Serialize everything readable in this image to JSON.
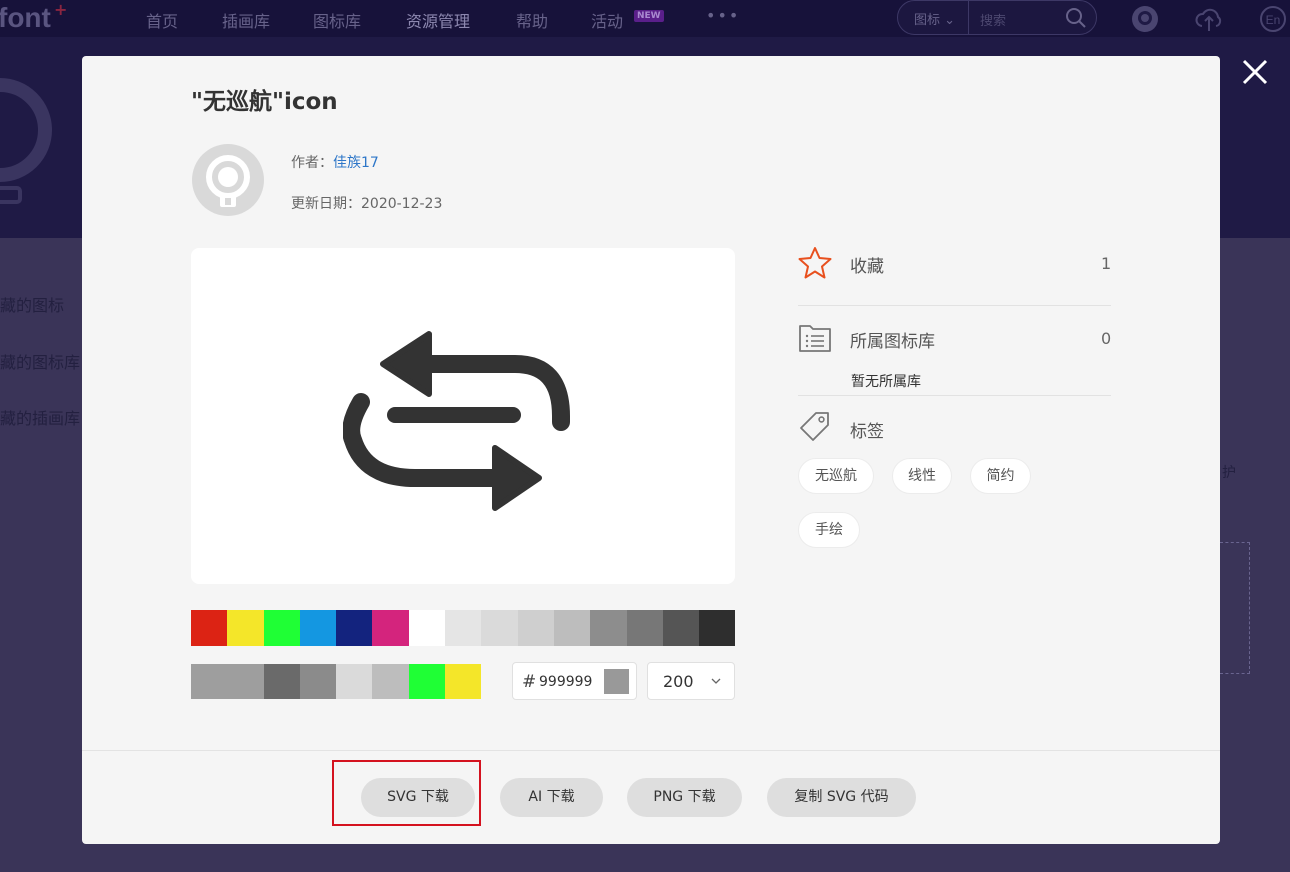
{
  "nav": {
    "logo": "font",
    "logo_plus": "+",
    "items": [
      "首页",
      "插画库",
      "图标库",
      "资源管理",
      "帮助",
      "活动"
    ],
    "new_badge": "NEW",
    "more": "•••",
    "search_category": "图标",
    "search_placeholder": "搜索"
  },
  "background": {
    "sidebar": [
      "藏的图标",
      "藏的图标库",
      "藏的插画库"
    ],
    "hint": "护"
  },
  "modal": {
    "title": "\"无巡航\"icon",
    "author_label": "作者：",
    "author_name": "佳族17",
    "date_label": "更新日期：",
    "date": "2020-12-23",
    "icon_name": "swap-loop-icon",
    "palette_row1": [
      "#dc2314",
      "#f4e629",
      "#1fff35",
      "#1497e1",
      "#13237e",
      "#d4247d",
      "#ffffff",
      "#e5e5e5",
      "#dadada",
      "#cfcfcf",
      "#bdbdbd",
      "#8d8d8d",
      "#777777",
      "#555555",
      "#2e2e2e"
    ],
    "palette_row2": [
      "#9e9e9e",
      "#9e9e9e",
      "#6a6a6a",
      "#8b8b8b",
      "#dadada",
      "#bdbdbd",
      "#1fff35",
      "#f4e629"
    ],
    "hex_hash": "#",
    "hex_value": "999999",
    "size_value": "200",
    "favorites": {
      "label": "收藏",
      "count": "1"
    },
    "library": {
      "label": "所属图标库",
      "count": "0",
      "empty": "暂无所属库"
    },
    "tags_label": "标签",
    "tags": [
      "无巡航",
      "线性",
      "简约",
      "手绘"
    ],
    "buttons": {
      "svg": "SVG 下载",
      "ai": "AI 下载",
      "png": "PNG 下载",
      "copy": "复制 SVG 代码"
    }
  },
  "colors": {
    "accent_star": "#e8501e",
    "highlight_box": "#d4121f",
    "link": "#2d76c8"
  }
}
